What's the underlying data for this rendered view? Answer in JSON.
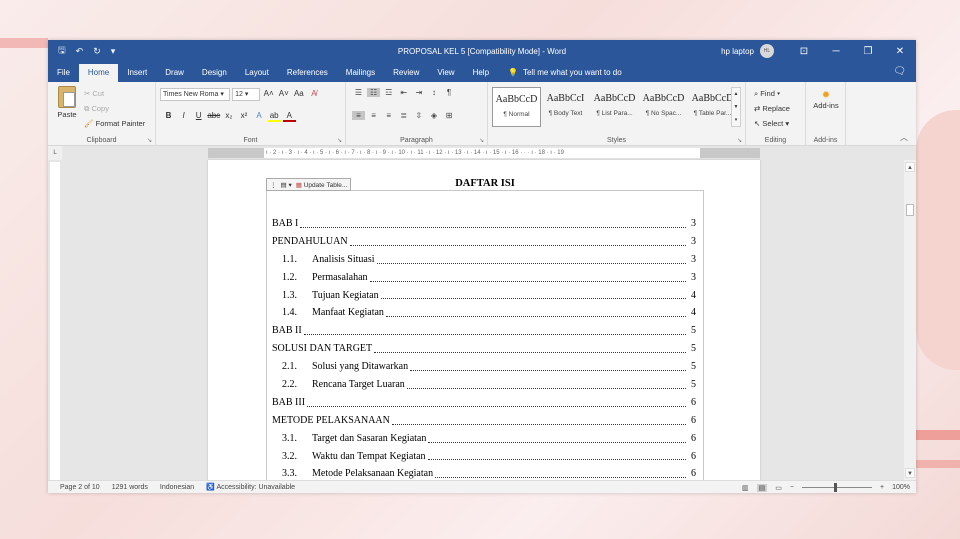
{
  "window": {
    "title": "PROPOSAL KEL 5 [Compatibility Mode]  -  Word",
    "user": "hp laptop",
    "avatar_initials": "HL"
  },
  "tabs": [
    "File",
    "Home",
    "Insert",
    "Draw",
    "Design",
    "Layout",
    "References",
    "Mailings",
    "Review",
    "View",
    "Help"
  ],
  "tell_me": "Tell me what you want to do",
  "ribbon": {
    "clipboard": {
      "paste": "Paste",
      "cut": "Cut",
      "copy": "Copy",
      "format_painter": "Format Painter",
      "label": "Clipboard"
    },
    "font": {
      "name": "Times New Roma",
      "size": "12",
      "label": "Font"
    },
    "paragraph": {
      "label": "Paragraph"
    },
    "styles": {
      "label": "Styles",
      "items": [
        {
          "sample": "AaBbCcD",
          "name": "¶ Normal"
        },
        {
          "sample": "AaBbCcI",
          "name": "¶ Body Text"
        },
        {
          "sample": "AaBbCcD",
          "name": "¶ List Para..."
        },
        {
          "sample": "AaBbCcD",
          "name": "¶ No Spac..."
        },
        {
          "sample": "AaBbCcD",
          "name": "¶ Table Par..."
        }
      ]
    },
    "editing": {
      "find": "Find",
      "replace": "Replace",
      "select": "Select",
      "label": "Editing"
    },
    "addins": {
      "button": "Add-ins",
      "label": "Add-ins"
    }
  },
  "ruler": "· 2 · ı · 1 · ı ·  ·  · ı · 1 · ı · 2 · ı · 3 · ı · 4 · ı · 5 · ı · 6 · ı · 7 · ı · 8 · ı · 9 · ı · 10 · ı · 11 · ı · 12 · ı · 13 · ı · 14 · ı · 15 · ı · 16 ·  ·  · ı · 18 · ı · 19",
  "toc": {
    "update_button": "Update Table...",
    "heading": "DAFTAR ISI",
    "rows": [
      {
        "num": "",
        "title": "BAB I",
        "page": "3",
        "sub": false
      },
      {
        "num": "",
        "title": "PENDAHULUAN",
        "page": "3",
        "sub": false
      },
      {
        "num": "1.1.",
        "title": "Analisis Situasi",
        "page": "3",
        "sub": true
      },
      {
        "num": "1.2.",
        "title": "Permasalahan",
        "page": "3",
        "sub": true
      },
      {
        "num": "1.3.",
        "title": "Tujuan Kegiatan",
        "page": "4",
        "sub": true
      },
      {
        "num": "1.4.",
        "title": "Manfaat Kegiatan",
        "page": "4",
        "sub": true
      },
      {
        "num": "",
        "title": "BAB II",
        "page": "5",
        "sub": false
      },
      {
        "num": "",
        "title": "SOLUSI DAN TARGET",
        "page": "5",
        "sub": false
      },
      {
        "num": "2.1.",
        "title": "Solusi yang Ditawarkan",
        "page": "5",
        "sub": true
      },
      {
        "num": "2.2.",
        "title": "Rencana Target Luaran",
        "page": "5",
        "sub": true
      },
      {
        "num": "",
        "title": "BAB III",
        "page": "6",
        "sub": false
      },
      {
        "num": "",
        "title": "METODE PELAKSANAAN",
        "page": "6",
        "sub": false
      },
      {
        "num": "3.1.",
        "title": "Target dan Sasaran Kegiatan",
        "page": "6",
        "sub": true
      },
      {
        "num": "3.2.",
        "title": "Waktu dan Tempat Kegiatan",
        "page": "6",
        "sub": true
      },
      {
        "num": "3.3.",
        "title": "Metode Pelaksanaan Kegiatan",
        "page": "6",
        "sub": true
      }
    ]
  },
  "status": {
    "page": "Page 2 of 10",
    "words": "1291 words",
    "language": "Indonesian",
    "accessibility": "Accessibility: Unavailable",
    "zoom": "100%"
  }
}
